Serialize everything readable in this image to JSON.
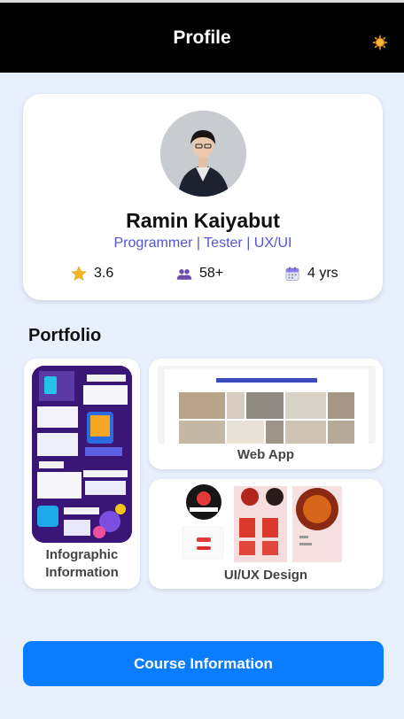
{
  "header": {
    "title": "Profile",
    "theme_icon": "sun-icon"
  },
  "profile": {
    "name": "Ramin Kaiyabut",
    "role": "Programmer | Tester | UX/UI",
    "stats": [
      {
        "icon": "star-icon",
        "value": "3.6"
      },
      {
        "icon": "users-icon",
        "value": "58+"
      },
      {
        "icon": "calendar-icon",
        "value": "4 yrs"
      }
    ]
  },
  "portfolio": {
    "title": "Portfolio",
    "items": [
      {
        "label": "Infographic Information"
      },
      {
        "label": "Web App"
      },
      {
        "label": "UI/UX Design"
      }
    ]
  },
  "course_button": {
    "label": "Course Information"
  },
  "colors": {
    "accent": "#0a7cff",
    "role": "#5454d6",
    "header": "#000000",
    "background": "#e8f0fe"
  }
}
